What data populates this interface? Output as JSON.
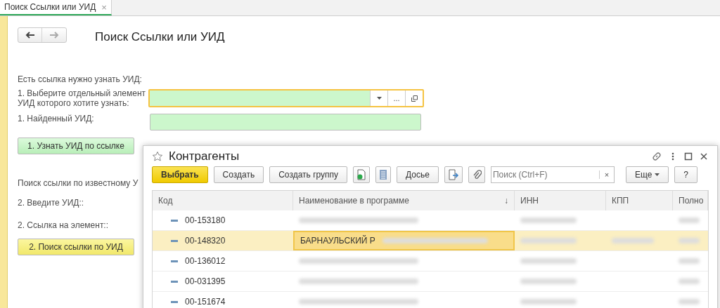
{
  "tabs": [
    {
      "label": "Поиск Ссылки или УИД",
      "close": "×",
      "selected": true
    }
  ],
  "form": {
    "title": "Поиск Ссылки или УИД",
    "section_1": "Есть ссылка нужно узнать УИД:",
    "field_1": {
      "label": "1. Выберите отдельный элемент УИД которого хотите узнать:",
      "focused": true,
      "more": "..."
    },
    "field_2": {
      "label": "1. Найденный УИД:"
    },
    "button_1": "1. Узнать УИД по ссылке",
    "section_2": "Поиск ссылки по известному У",
    "label_3": "2. Введите УИД::",
    "label_4": "2. Ссылка на элемент::",
    "button_2": "2. Поиск ссылки по УИД"
  },
  "dialog": {
    "title": "Контрагенты",
    "toolbar": [
      {
        "kind": "primary",
        "label": "Выбрать"
      },
      {
        "kind": "button",
        "label": "Создать"
      },
      {
        "kind": "button",
        "label": "Создать группу"
      },
      {
        "kind": "add"
      },
      {
        "kind": "list"
      },
      {
        "kind": "button",
        "label": "Досье"
      },
      {
        "kind": "export"
      },
      {
        "kind": "clip"
      },
      {
        "kind": "search",
        "placeholder": "Поиск (Ctrl+F)",
        "clear": "×"
      },
      {
        "kind": "menu",
        "label": "Еще"
      },
      {
        "kind": "button",
        "label": "?"
      }
    ],
    "columns": [
      {
        "label": "Код"
      },
      {
        "label": "Наименование в программе",
        "sort": "↓"
      },
      {
        "label": "ИНН"
      },
      {
        "label": "КПП"
      },
      {
        "label": "Полно"
      }
    ],
    "rows": [
      {
        "code": "00-153180",
        "selected": false
      },
      {
        "code": "00-148320",
        "name": "БАРНАУЛЬСКИЙ Р",
        "selected": true
      },
      {
        "code": "00-136012",
        "selected": false
      },
      {
        "code": "00-031395",
        "selected": false
      },
      {
        "code": "00-151674",
        "selected": false
      }
    ]
  }
}
